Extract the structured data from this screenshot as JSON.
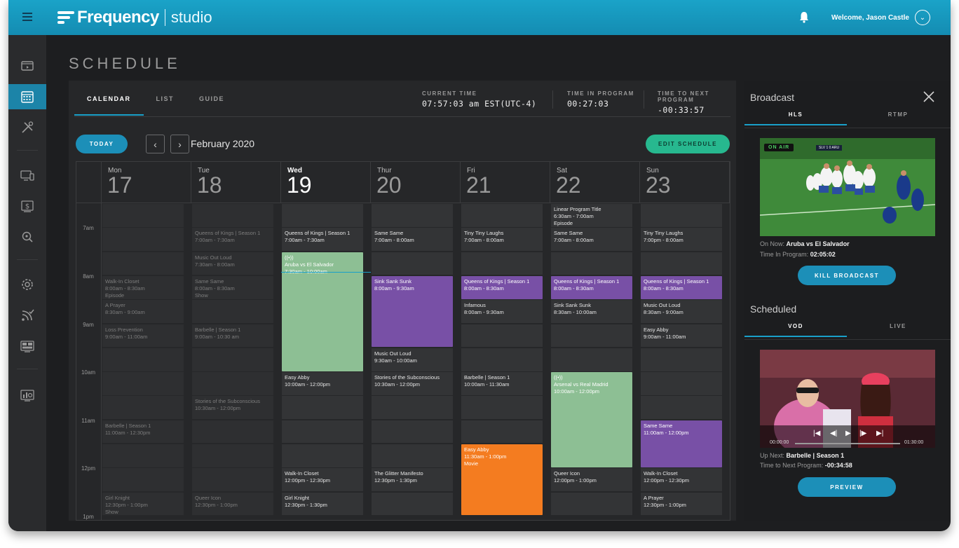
{
  "app": {
    "brand": "Frequency",
    "product": "studio",
    "welcome": "Welcome, Jason Castle",
    "page_title": "SCHEDULE"
  },
  "colors": {
    "topbar": "#1aa3c8",
    "accent": "#1c8fb8",
    "edit_button": "#27b88f",
    "event_purple": "#7850a6",
    "event_green": "#8dbf94",
    "event_orange": "#f47c20"
  },
  "sidenav": {
    "icons": [
      "channels-icon",
      "calendar-icon",
      "tools-icon",
      "devices-icon",
      "monetization-icon",
      "analytics-search-icon",
      "settings-icon",
      "feeds-icon",
      "layout-icon",
      "reports-icon"
    ],
    "active": "calendar-icon"
  },
  "tabs": [
    "CALENDAR",
    "LIST",
    "GUIDE"
  ],
  "stats": {
    "current_time_label": "CURRENT TIME",
    "current_time": "07:57:03 am EST(UTC-4)",
    "time_in_program_label": "TIME IN PROGRAM",
    "time_in_program": "00:27:03",
    "time_to_next_label": "TIME TO NEXT PROGRAM",
    "time_to_next": "-00:33:57"
  },
  "toolbar": {
    "today": "TODAY",
    "month": "February 2020",
    "edit_schedule": "EDIT SCHEDULE",
    "prev": "‹",
    "next": "›"
  },
  "days": [
    {
      "name": "Mon",
      "date": "17"
    },
    {
      "name": "Tue",
      "date": "18"
    },
    {
      "name": "Wed",
      "date": "19"
    },
    {
      "name": "Thur",
      "date": "20"
    },
    {
      "name": "Fri",
      "date": "21"
    },
    {
      "name": "Sat",
      "date": "22"
    },
    {
      "name": "Sun",
      "date": "23"
    }
  ],
  "hours": [
    "7am",
    "8am",
    "9am",
    "10am",
    "11am",
    "12pm",
    "1pm"
  ],
  "events": [
    {
      "day": 0,
      "start": 3,
      "span": 1,
      "title": "Walk-In Closet",
      "time": "8:00am - 8:30am",
      "sub": "Episode",
      "style": "dim"
    },
    {
      "day": 0,
      "start": 4,
      "span": 1,
      "title": "A Prayer",
      "time": "8:30am - 9:00am",
      "style": "dim"
    },
    {
      "day": 0,
      "start": 5,
      "span": 1,
      "title": "Loss Prevention",
      "time": "9:00am - 11:00am",
      "style": "dim"
    },
    {
      "day": 0,
      "start": 9,
      "span": 1,
      "title": "Barbelle | Season 1",
      "time": "11:00am - 12:30pm",
      "style": "dim"
    },
    {
      "day": 0,
      "start": 12,
      "span": 1,
      "title": "Girl Knight",
      "time": "12:30pm - 1:00pm",
      "sub": "Show",
      "style": "dim"
    },
    {
      "day": 1,
      "start": 1,
      "span": 1,
      "title": "Queens of Kings | Season 1",
      "time": "7:00am - 7:30am",
      "style": "dim"
    },
    {
      "day": 1,
      "start": 2,
      "span": 1,
      "title": "Music Out Loud",
      "time": "7:30am - 8:00am",
      "style": "dim"
    },
    {
      "day": 1,
      "start": 3,
      "span": 1,
      "title": "Same Same",
      "time": "8:00am - 8:30am",
      "sub": "Show",
      "style": "dim"
    },
    {
      "day": 1,
      "start": 5,
      "span": 1,
      "title": "Barbelle | Season 1",
      "time": "9:00am - 10:30 am",
      "style": "dim"
    },
    {
      "day": 1,
      "start": 8,
      "span": 1,
      "title": "Stories of the Subconscious",
      "time": "10:30am - 12:00pm",
      "style": "dim"
    },
    {
      "day": 1,
      "start": 12,
      "span": 1,
      "title": "Queer Icon",
      "time": "12:30pm - 1:00pm",
      "style": "dim"
    },
    {
      "day": 2,
      "start": 1,
      "span": 1,
      "title": "Queens of Kings | Season 1",
      "time": "7:00am - 7:30am",
      "style": "normal"
    },
    {
      "day": 2,
      "start": 2,
      "span": 5,
      "title": "Aruba vs El Salvador",
      "time": "7:30am - 10:00am",
      "live": "((•))",
      "style": "green"
    },
    {
      "day": 2,
      "start": 7,
      "span": 1,
      "title": "Easy Abby",
      "time": "10:00am - 12:00pm",
      "style": "normal"
    },
    {
      "day": 2,
      "start": 11,
      "span": 1,
      "title": "Walk-In Closet",
      "time": "12:00pm - 12:30pm",
      "style": "normal"
    },
    {
      "day": 2,
      "start": 12,
      "span": 1,
      "title": "Girl Knight",
      "time": "12:30pm - 1:30pm",
      "style": "normal"
    },
    {
      "day": 3,
      "start": 1,
      "span": 1,
      "title": "Same Same",
      "time": "7:00am - 8:00am",
      "style": "normal"
    },
    {
      "day": 3,
      "start": 3,
      "span": 3,
      "title": "Sink Sank Sunk",
      "time": "8:00am - 9:30am",
      "style": "purple"
    },
    {
      "day": 3,
      "start": 6,
      "span": 1,
      "title": "Music Out Loud",
      "time": "9:30am - 10:00am",
      "style": "normal"
    },
    {
      "day": 3,
      "start": 7,
      "span": 1,
      "title": "Stories of the Subconscious",
      "time": "10:30am - 12:00pm",
      "style": "normal"
    },
    {
      "day": 3,
      "start": 11,
      "span": 1,
      "title": "The Glitter Manifesto",
      "time": "12:30pm - 1:30pm",
      "style": "normal"
    },
    {
      "day": 4,
      "start": 1,
      "span": 1,
      "title": "Tiny Tiny Laughs",
      "time": "7:00am - 8:00am",
      "style": "normal"
    },
    {
      "day": 4,
      "start": 3,
      "span": 1,
      "title": "Queens of Kings | Season 1",
      "time": "8:00am - 8:30am",
      "style": "purple"
    },
    {
      "day": 4,
      "start": 4,
      "span": 1,
      "title": "Infamous",
      "time": "8:00am - 9:30am",
      "style": "normal"
    },
    {
      "day": 4,
      "start": 7,
      "span": 1,
      "title": "Barbelle | Season 1",
      "time": "10:00am - 11:30am",
      "style": "normal"
    },
    {
      "day": 4,
      "start": 10,
      "span": 3,
      "title": "Easy Abby",
      "time": "11:30am - 1:00pm",
      "sub": "Movie",
      "style": "orange"
    },
    {
      "day": 5,
      "start": 0,
      "span": 1,
      "title": "Linear Program Title",
      "time": "6:30am - 7:00am",
      "sub": "Episode",
      "style": "normal"
    },
    {
      "day": 5,
      "start": 1,
      "span": 1,
      "title": "Same Same",
      "time": "7:00am - 8:00am",
      "style": "normal"
    },
    {
      "day": 5,
      "start": 3,
      "span": 1,
      "title": "Queens of Kings | Season 1",
      "time": "8:00am - 8:30am",
      "style": "purple"
    },
    {
      "day": 5,
      "start": 4,
      "span": 1,
      "title": "Sink Sank Sunk",
      "time": "8:30am - 10:00am",
      "style": "normal"
    },
    {
      "day": 5,
      "start": 7,
      "span": 4,
      "title": "Arsenal vs Real Madrid",
      "time": "10:00am - 12:00pm",
      "live": "((•))",
      "style": "green"
    },
    {
      "day": 5,
      "start": 11,
      "span": 1,
      "title": "Queer Icon",
      "time": "12:00pm - 1:00pm",
      "style": "normal"
    },
    {
      "day": 6,
      "start": 1,
      "span": 1,
      "title": "Tiny Tiny Laughs",
      "time": "7:00pm - 8:00am",
      "style": "normal"
    },
    {
      "day": 6,
      "start": 3,
      "span": 1,
      "title": "Queens of Kings | Season 1",
      "time": "8:00am - 8:30am",
      "style": "purple"
    },
    {
      "day": 6,
      "start": 4,
      "span": 1,
      "title": "Music Out Loud",
      "time": "8:30am - 9:00am",
      "style": "normal"
    },
    {
      "day": 6,
      "start": 5,
      "span": 1,
      "title": "Easy Abby",
      "time": "9:00am - 11:00am",
      "style": "normal"
    },
    {
      "day": 6,
      "start": 9,
      "span": 2,
      "title": "Same Same",
      "time": "11:00am - 12:00pm",
      "style": "purple"
    },
    {
      "day": 6,
      "start": 11,
      "span": 1,
      "title": "Walk-In Closet",
      "time": "12:00pm - 12:30pm",
      "style": "normal"
    },
    {
      "day": 6,
      "start": 12,
      "span": 1,
      "title": "A Prayer",
      "time": "12:30pm - 1:00pm",
      "style": "normal"
    }
  ],
  "broadcast": {
    "title": "Broadcast",
    "tabs": [
      "HLS",
      "RTMP"
    ],
    "on_air": "ON AIR",
    "on_now_label": "On Now:",
    "on_now": "Aruba vs El Salvador",
    "time_in_program_label": "Time In Program:",
    "time_in_program": "02:05:02",
    "kill": "KILL BROADCAST"
  },
  "scheduled": {
    "title": "Scheduled",
    "tabs": [
      "VOD",
      "LIVE"
    ],
    "time_start": "00:00:00",
    "time_end": "01:30:00",
    "up_next_label": "Up Next:",
    "up_next": "Barbelle | Season 1",
    "time_to_next_label": "Time to Next Program:",
    "time_to_next": "-00:34:58",
    "preview": "PREVIEW"
  }
}
